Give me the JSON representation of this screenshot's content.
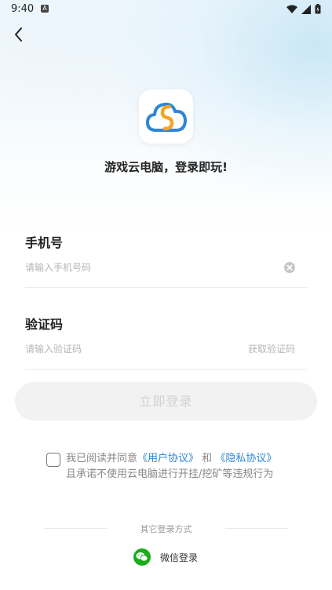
{
  "status_bar": {
    "time": "9:40",
    "notification_icon": "A"
  },
  "header": {
    "back_icon": "chevron-left-icon"
  },
  "app": {
    "tagline": "游戏云电脑，登录即玩!",
    "logo_colors": {
      "cloud": "#2f86d8",
      "swirl": "#f5a623"
    }
  },
  "phone": {
    "label": "手机号",
    "placeholder": "请输入手机号码",
    "value": ""
  },
  "code": {
    "label": "验证码",
    "placeholder": "请输入验证码",
    "value": "",
    "get_code_label": "获取验证码"
  },
  "login_button_label": "立即登录",
  "agreement": {
    "prefix": "我已阅读并同意",
    "user_agreement": "《用户协议》",
    "and": "和",
    "privacy_agreement": "《隐私协议》",
    "line2": "且承诺不使用云电脑进行开挂/挖矿等违规行为",
    "checked": false
  },
  "other_login": {
    "title": "其它登录方式",
    "wechat_label": "微信登录"
  },
  "colors": {
    "accent": "#2f86d8",
    "wechat": "#1aad19",
    "disabled_button_bg": "#f2f2f2"
  }
}
